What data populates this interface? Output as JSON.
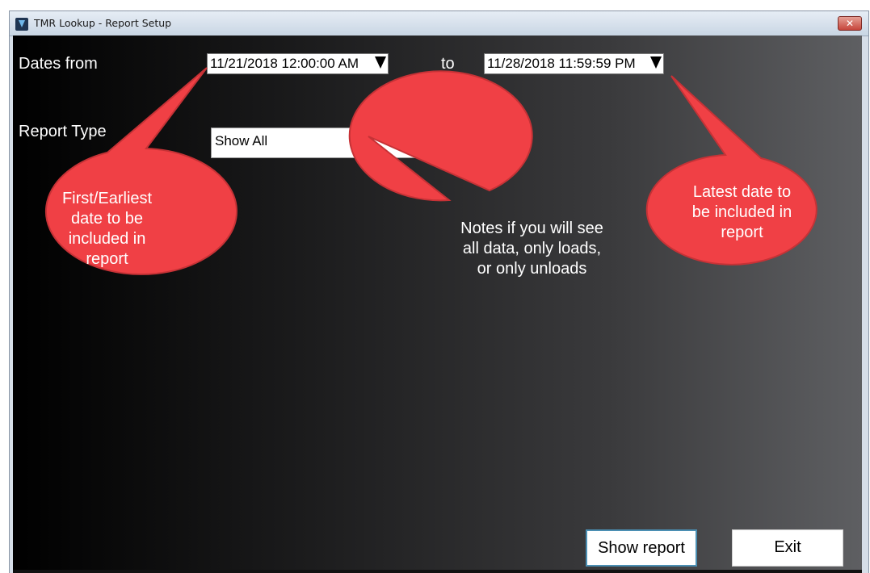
{
  "window": {
    "title": "TMR Lookup - Report Setup",
    "close_glyph": "✕"
  },
  "form": {
    "dates_from_label": "Dates from",
    "to_label": "to",
    "date_from_value": "11/21/2018 12:00:00 AM",
    "date_to_value": "11/28/2018 11:59:59 PM",
    "report_type_label": "Report Type",
    "report_type_value": "Show All"
  },
  "callouts": {
    "first_date": "First/Earliest date to be included in report",
    "report_type": "Notes if you will see all data, only loads, or only unloads",
    "latest_date": "Latest date to be included in report"
  },
  "buttons": {
    "show_report": "Show report",
    "exit": "Exit"
  },
  "colors": {
    "callout_fill": "#f04045",
    "callout_border": "#c63236",
    "focus_border": "#4b8fb3"
  },
  "icons": {
    "app": "tmr-app-icon",
    "close": "close-icon",
    "dropdown": "chevron-down-icon"
  }
}
